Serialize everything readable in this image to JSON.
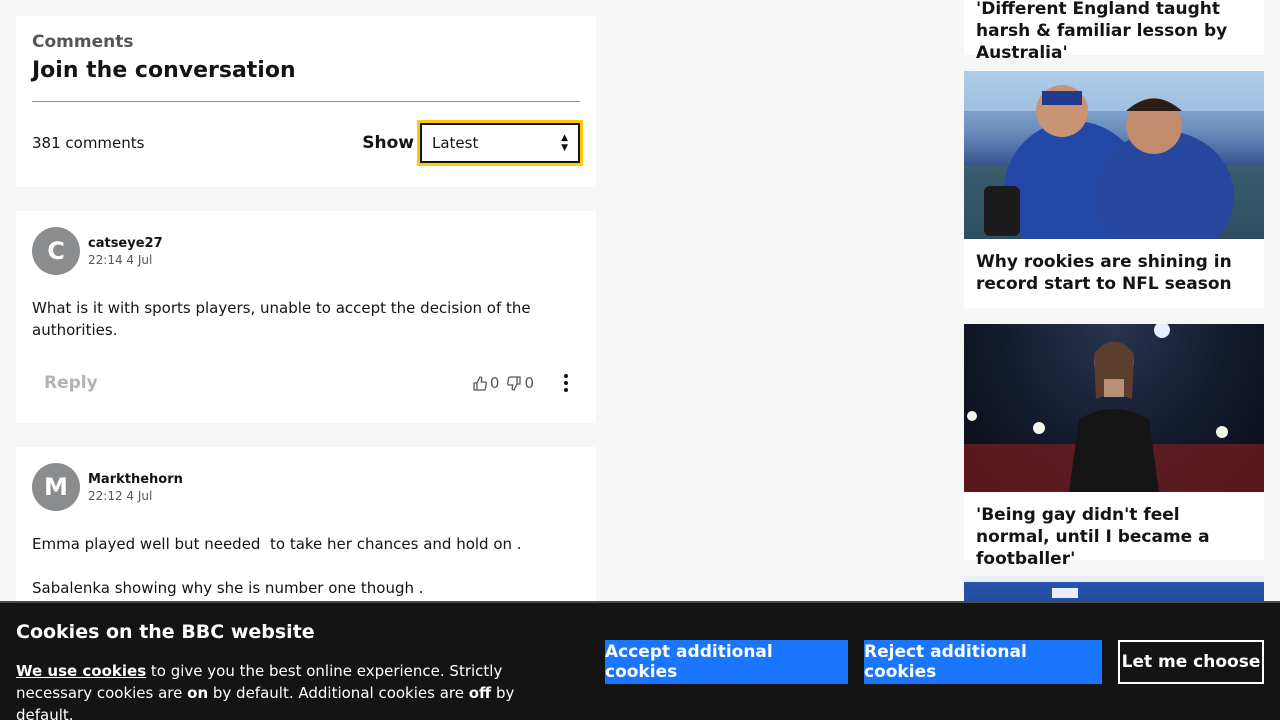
{
  "comments_section": {
    "kicker": "Comments",
    "title": "Join the conversation",
    "count": "381 comments",
    "show_label": "Show",
    "sort_value": "Latest"
  },
  "comments": [
    {
      "initial": "C",
      "user": "catseye27",
      "time": "22:14 4 Jul",
      "body": [
        "What is it with sports players, unable to accept the decision of the authorities."
      ],
      "reply_label": "Reply",
      "likes": "0",
      "dislikes": "0"
    },
    {
      "initial": "M",
      "user": "Markthehorn",
      "time": "22:12 4 Jul",
      "body": [
        "Emma played well but needed  to take her chances and hold on .",
        "Sabalenka showing why she is number one though ."
      ]
    }
  ],
  "promos": [
    {
      "title": "'Different England taught harsh & familiar lesson by Australia'"
    },
    {
      "title": "Why rookies are shining in record start to NFL season",
      "image": "nfl-players-photo"
    },
    {
      "title": "'Being gay didn't feel normal, until I became a footballer'",
      "image": "footballer-photo"
    },
    {
      "image": "stadium-photo"
    }
  ],
  "cookie_banner": {
    "title": "Cookies on the BBC website",
    "link_text": "We use cookies",
    "text_1": " to give you the best online experience. Strictly necessary cookies are ",
    "on": "on",
    "text_2": " by default. Additional cookies are ",
    "off": "off",
    "text_3": " by default.",
    "accept_label": "Accept additional cookies",
    "reject_label": "Reject additional cookies",
    "choose_label": "Let me choose"
  },
  "colors": {
    "accent_blue": "#1a75ff",
    "focus_yellow": "#ffcc00",
    "banner_bg": "#141414"
  }
}
